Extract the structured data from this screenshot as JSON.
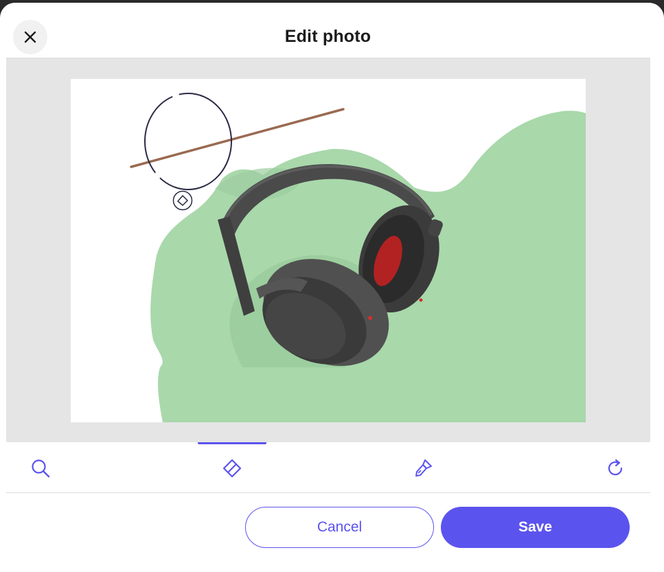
{
  "dialog": {
    "title": "Edit photo",
    "close_icon": "close-icon"
  },
  "toolbar": {
    "tools": [
      {
        "name": "zoom",
        "icon": "magnifier-icon"
      },
      {
        "name": "erase",
        "icon": "eraser-icon",
        "active": true
      },
      {
        "name": "restore",
        "icon": "brush-icon"
      },
      {
        "name": "reset",
        "icon": "refresh-icon"
      }
    ]
  },
  "actions": {
    "cancel_label": "Cancel",
    "save_label": "Save"
  },
  "colors": {
    "accent": "#5b53ee",
    "background_mask": "#a8d8a8",
    "canvas_bg": "#e5e5e5"
  }
}
